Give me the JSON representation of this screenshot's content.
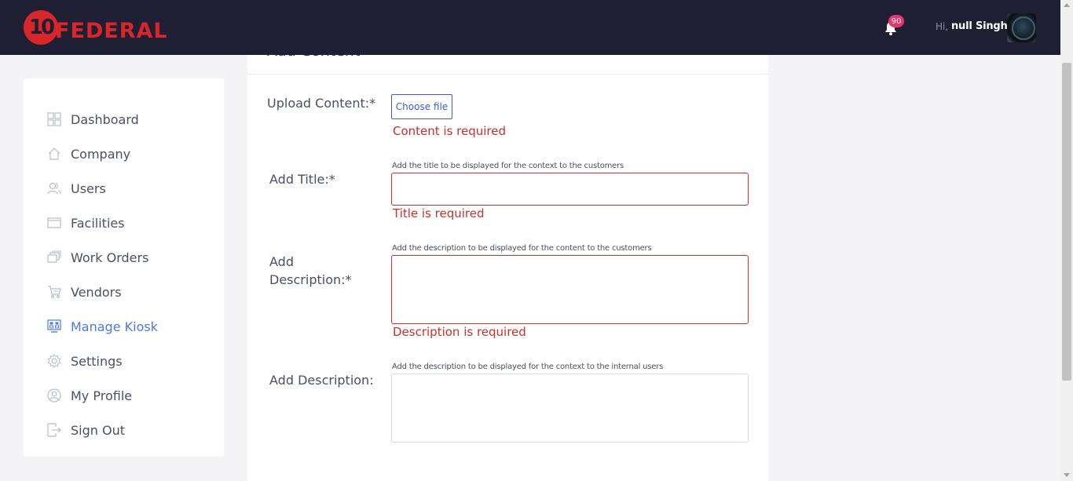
{
  "header": {
    "logo_number": "10",
    "logo_text": "FEDERAL",
    "notification_count": "90",
    "greeting": "Hi,",
    "username": "null Singh"
  },
  "sidebar": {
    "items": [
      {
        "label": "Dashboard",
        "icon": "dashboard-icon"
      },
      {
        "label": "Company",
        "icon": "home-icon"
      },
      {
        "label": "Users",
        "icon": "users-icon"
      },
      {
        "label": "Facilities",
        "icon": "facilities-icon"
      },
      {
        "label": "Work Orders",
        "icon": "work-orders-icon"
      },
      {
        "label": "Vendors",
        "icon": "cart-icon"
      },
      {
        "label": "Manage Kiosk",
        "icon": "kiosk-icon",
        "active": true
      },
      {
        "label": "Settings",
        "icon": "gear-icon"
      },
      {
        "label": "My Profile",
        "icon": "profile-icon"
      },
      {
        "label": "Sign Out",
        "icon": "sign-out-icon"
      }
    ]
  },
  "form": {
    "title": "Add Content",
    "upload": {
      "label": "Upload Content:*",
      "button": "Choose file",
      "error": "Content is required"
    },
    "title_field": {
      "label": "Add Title:*",
      "hint": "Add the title to be displayed for the context to the customers",
      "value": "",
      "error": "Title is required"
    },
    "description_field": {
      "label_line1": "Add",
      "label_line2": "Description:*",
      "hint": "Add the description to be displayed for the content to the customers",
      "value": "",
      "error": "Description is required"
    },
    "internal_description_field": {
      "label": "Add Description:",
      "hint": "Add the description to be displayed for the context to the internal users",
      "value": ""
    }
  },
  "colors": {
    "topbar": "#1f1f33",
    "brand_red": "#d9262b",
    "active_nav": "#4e79dd",
    "error": "#c9302c",
    "badge": "#e8336c"
  }
}
